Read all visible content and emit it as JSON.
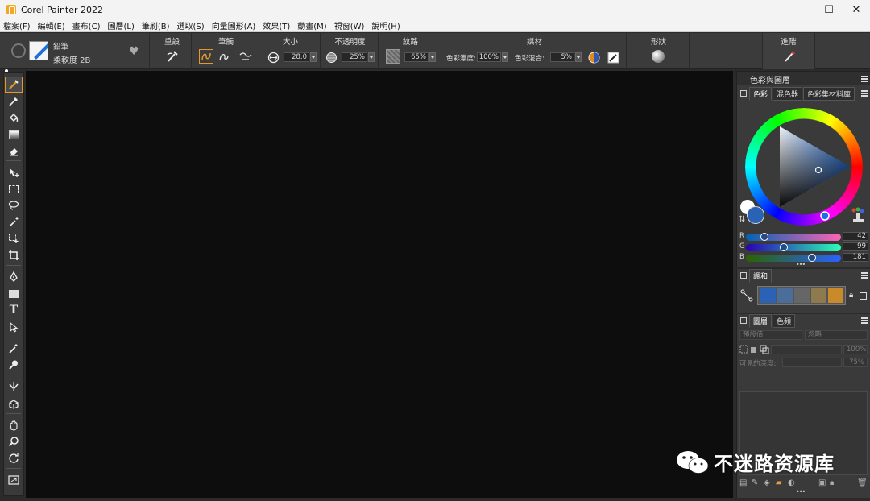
{
  "window": {
    "title": "Corel Painter 2022",
    "minimize": "—",
    "maximize": "☐",
    "close": "✕"
  },
  "menu": [
    "檔案(F)",
    "編輯(E)",
    "畫布(C)",
    "圖層(L)",
    "筆刷(B)",
    "選取(S)",
    "向量圖形(A)",
    "效果(T)",
    "動畫(M)",
    "視窗(W)",
    "說明(H)"
  ],
  "brush": {
    "category": "鉛筆",
    "variant": "柔軟度 2B"
  },
  "propbar": {
    "reset_label": "重設",
    "stroke_label": "筆觸",
    "size_label": "大小",
    "size_value": "28.0",
    "opacity_label": "不透明度",
    "opacity_value": "25%",
    "grain_label": "紋路",
    "grain_value": "65%",
    "media_label": "媒材",
    "resat_label": "色彩濃度:",
    "resat_value": "100%",
    "bleed_label": "色彩混合:",
    "bleed_value": "5%",
    "shape_label": "形狀",
    "advanced_label": "進階"
  },
  "color_panel": {
    "title": "色彩與圖層",
    "tabs": [
      "色彩",
      "混色器",
      "色彩集材料庫"
    ],
    "r_label": "R",
    "g_label": "G",
    "b_label": "B",
    "r": 42,
    "g": 99,
    "b": 181,
    "main_color": "#2a63b5",
    "more_dots": "•••"
  },
  "harmony_panel": {
    "title": "調和",
    "swatches": [
      "#2a63b5",
      "#4a6d9a",
      "#666666",
      "#8f7a4e",
      "#c88a2a"
    ]
  },
  "layers_panel": {
    "tabs": [
      "圖層",
      "色頻"
    ],
    "composite_method": "預設值",
    "composite_depth": "忽略",
    "opacity_value": "100%",
    "depth_label": "可見的深度:",
    "depth_value": "75%",
    "more_dots": "•••"
  },
  "watermark": {
    "text": "不迷路资源库"
  }
}
